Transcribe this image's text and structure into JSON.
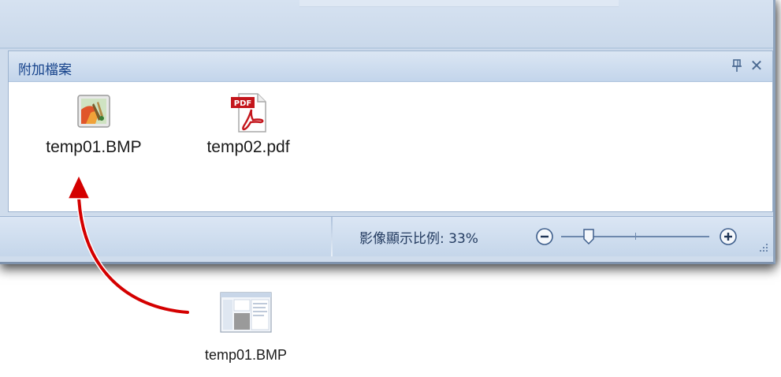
{
  "pane": {
    "title": "附加檔案",
    "pin_icon": "pin-icon",
    "close_icon": "close-icon",
    "close_glyph": "✕"
  },
  "attachments": [
    {
      "name": "temp01.BMP",
      "icon": "bitmap-file-icon"
    },
    {
      "name": "temp02.pdf",
      "icon": "pdf-file-icon",
      "badge": "PDF"
    }
  ],
  "statusbar": {
    "zoom_label": "影像顯示比例: 33%",
    "zoom_percent": 33
  },
  "dragged_file": {
    "name": "temp01.BMP",
    "icon": "bitmap-file-icon"
  },
  "colors": {
    "arrow": "#d40000",
    "pdf_red": "#c4161c",
    "title_blue": "#15428b"
  }
}
